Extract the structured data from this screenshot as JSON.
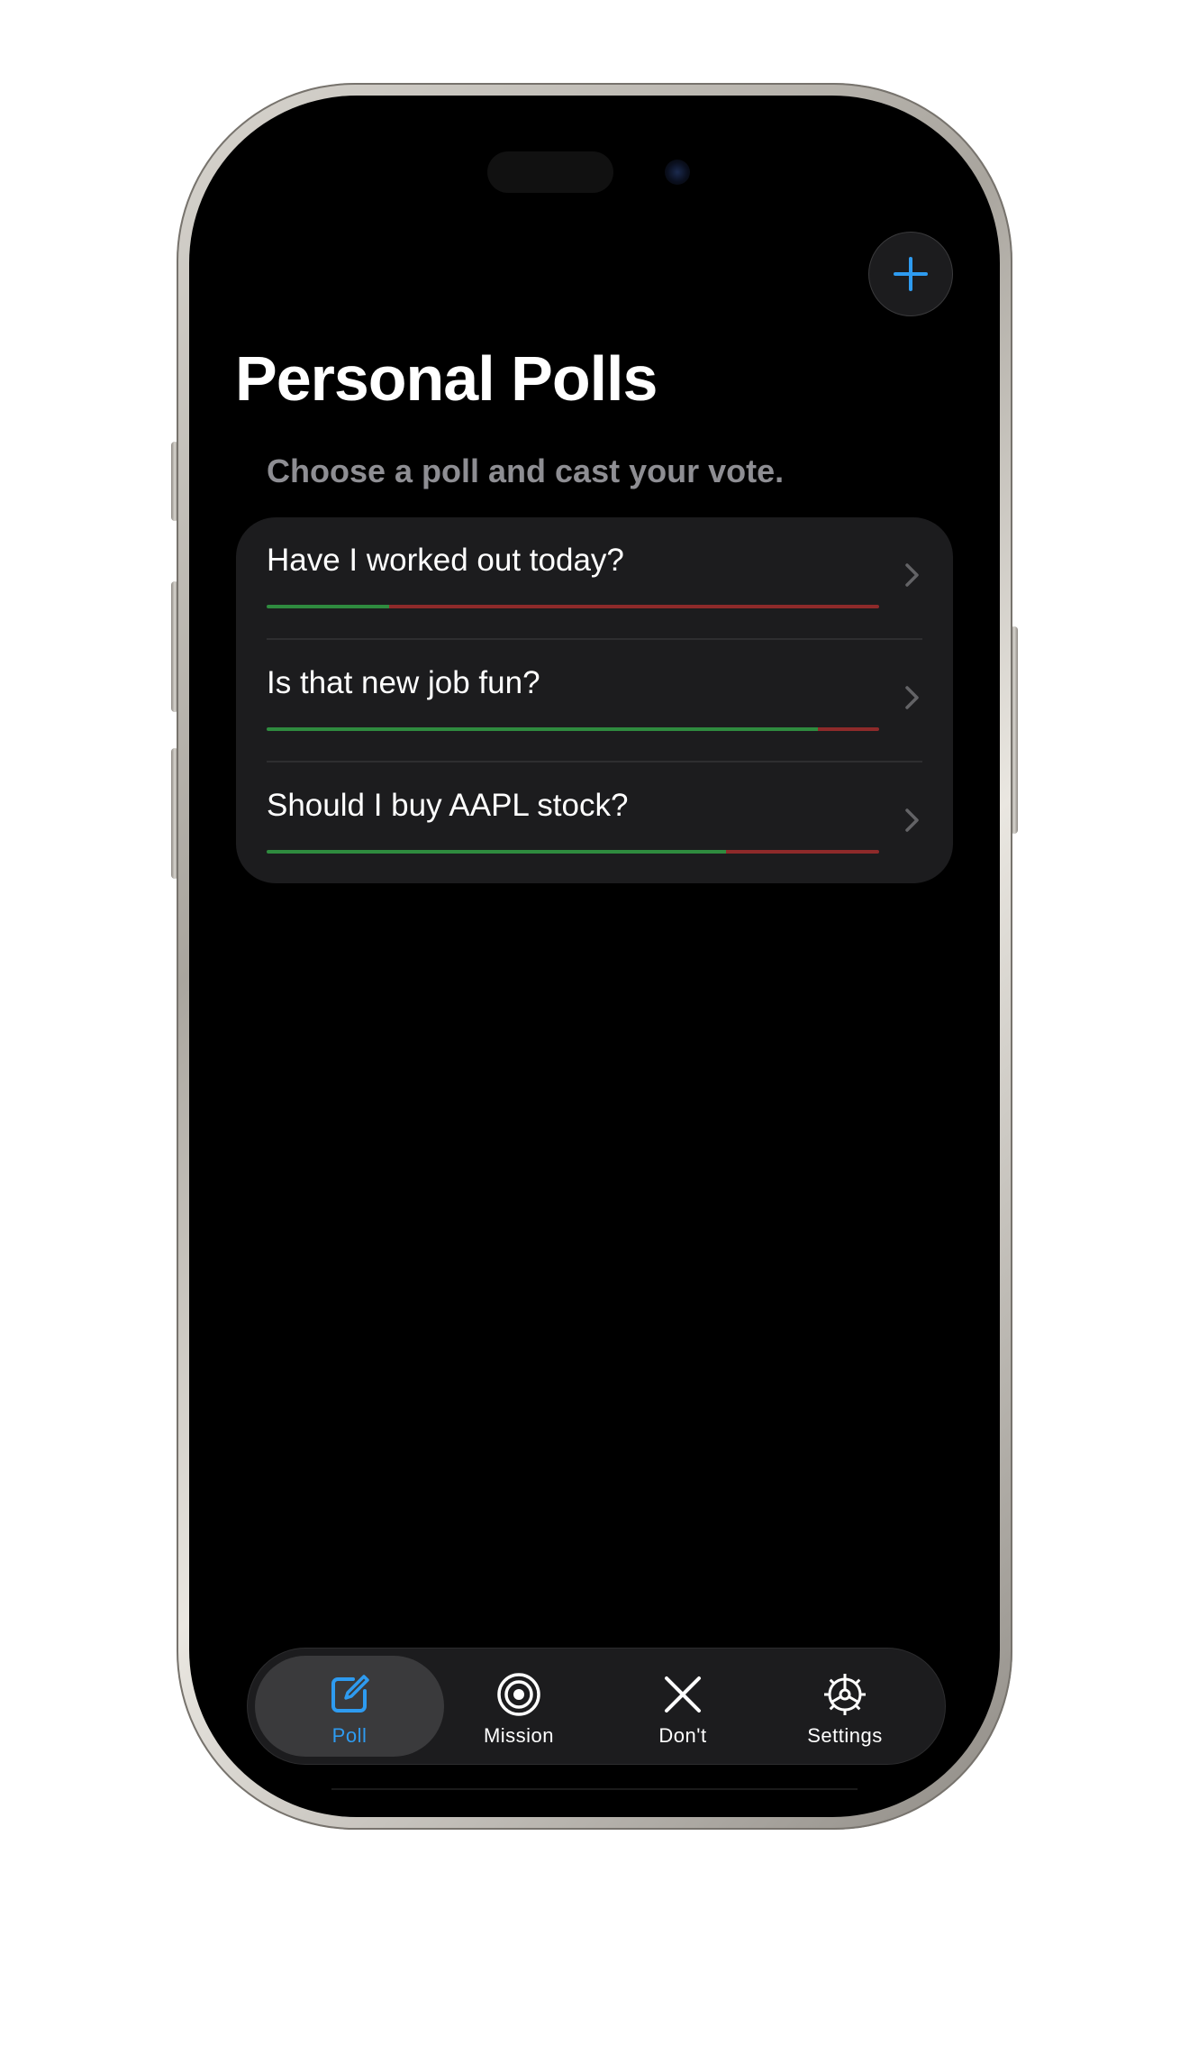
{
  "colors": {
    "accent": "#2e9bf0",
    "background": "#000000",
    "card": "#1c1c1e",
    "yes_bar": "#2f8b3f",
    "no_bar": "#8e2a2a",
    "subtitle": "#8e8e93"
  },
  "header": {
    "add_icon": "plus-icon",
    "title": "Personal Polls",
    "subtitle": "Choose a poll and cast your vote."
  },
  "polls": [
    {
      "question": "Have I worked out today?",
      "yes_fraction": 0.2
    },
    {
      "question": "Is that new job fun?",
      "yes_fraction": 0.9
    },
    {
      "question": "Should I buy AAPL stock?",
      "yes_fraction": 0.75
    }
  ],
  "tab_bar": {
    "tabs": [
      {
        "label": "Poll",
        "icon": "compose-icon",
        "active": true
      },
      {
        "label": "Mission",
        "icon": "target-icon",
        "active": false
      },
      {
        "label": "Don't",
        "icon": "xmark-icon",
        "active": false
      },
      {
        "label": "Settings",
        "icon": "gear-icon",
        "active": false
      }
    ]
  }
}
